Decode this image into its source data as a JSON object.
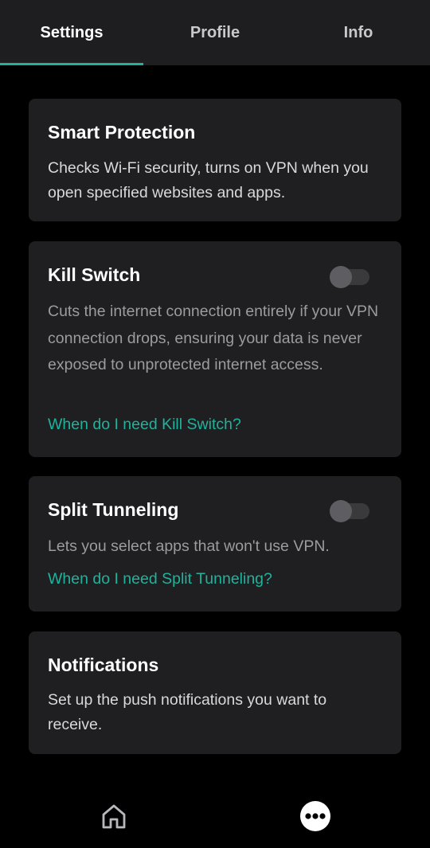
{
  "tabs": {
    "settings_label": "Settings",
    "profile_label": "Profile",
    "info_label": "Info",
    "active": "Settings",
    "accent_color": "#1fb39c"
  },
  "cards": {
    "smart_protection": {
      "title": "Smart Protection",
      "description": "Checks Wi-Fi security, turns on VPN when you open specified websites and apps."
    },
    "kill_switch": {
      "title": "Kill Switch",
      "description": "Cuts the internet connection entirely if your VPN connection drops, ensuring your data is never exposed to unprotected internet access.",
      "link": "When do I need Kill Switch?",
      "enabled": false
    },
    "split_tunneling": {
      "title": "Split Tunneling",
      "description": "Lets you select apps that won't use VPN.",
      "link": "When do I need Split Tunneling?",
      "enabled": false
    },
    "notifications": {
      "title": "Notifications",
      "description": "Set up the push notifications you want to receive."
    }
  },
  "bottom_nav": {
    "home_icon": "home-icon",
    "more_icon": "more-icon"
  }
}
